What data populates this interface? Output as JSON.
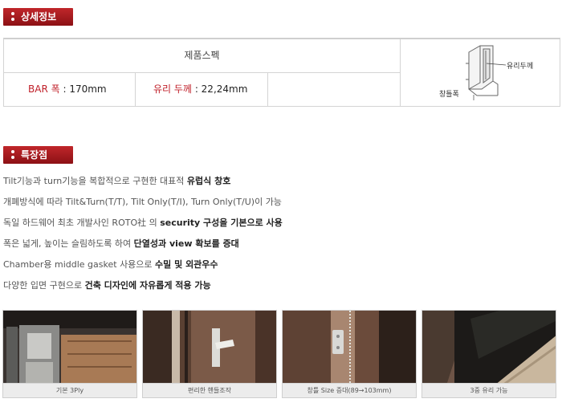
{
  "sections": {
    "detail_title": "상세정보",
    "features_title": "특장점"
  },
  "spec": {
    "header": "제품스펙",
    "bar_label": "BAR 폭",
    "bar_value": "170mm",
    "glass_label": "유리 두께",
    "glass_value": "22,24mm",
    "diagram_glass_label": "유리두께",
    "diagram_frame_label": "창틀폭"
  },
  "features": [
    {
      "pre": "Tilt기능과 turn기능을 복합적으로 구현한 대표적 ",
      "bold": "유럽식 창호",
      "post": ""
    },
    {
      "pre": "개폐방식에 따라 Tilt&Turn(T/T), Tilt Only(T/I), Turn Only(T/U)이 가능",
      "bold": "",
      "post": ""
    },
    {
      "pre": "독일 하드웨어 최초 개발사인 ROTO社 의 ",
      "bold": "security 구성을 기본으로 사용",
      "post": ""
    },
    {
      "pre": "폭은 넓게, 높이는 슬림하도록 하여 ",
      "bold": "단열성과 view 확보를 증대",
      "post": ""
    },
    {
      "pre": "Chamber용 middle gasket 사용으로 ",
      "bold": "수밀 및 외관우수",
      "post": ""
    },
    {
      "pre": "다양한 입면 구현으로 ",
      "bold": "건축 디자인에 자유롭게 적용 가능",
      "post": ""
    }
  ],
  "photos": [
    {
      "caption": "기본 3Ply"
    },
    {
      "caption": "편리한 핸들조작"
    },
    {
      "caption": "창틀 Size 증대(89→103mm)"
    },
    {
      "caption": "3중 유리 가능"
    }
  ],
  "colors": {
    "accent": "#b0191e",
    "key_label": "#c0202a"
  }
}
